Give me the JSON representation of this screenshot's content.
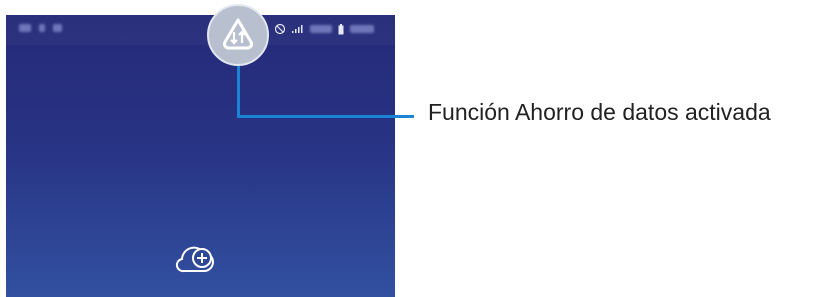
{
  "callout": {
    "label": "Función Ahorro de datos activada"
  },
  "status_bar": {
    "right_icons": [
      "block-icon",
      "signal-icon",
      "battery-icon"
    ]
  },
  "home_screen": {
    "icon": "cloud-add-icon"
  },
  "badge": {
    "icon": "data-saver-icon"
  },
  "colors": {
    "wallpaper_top": "#252a78",
    "wallpaper_bottom": "#3250a0",
    "callout_line": "#1a84d6",
    "badge_bg": "#b8c0d0"
  }
}
